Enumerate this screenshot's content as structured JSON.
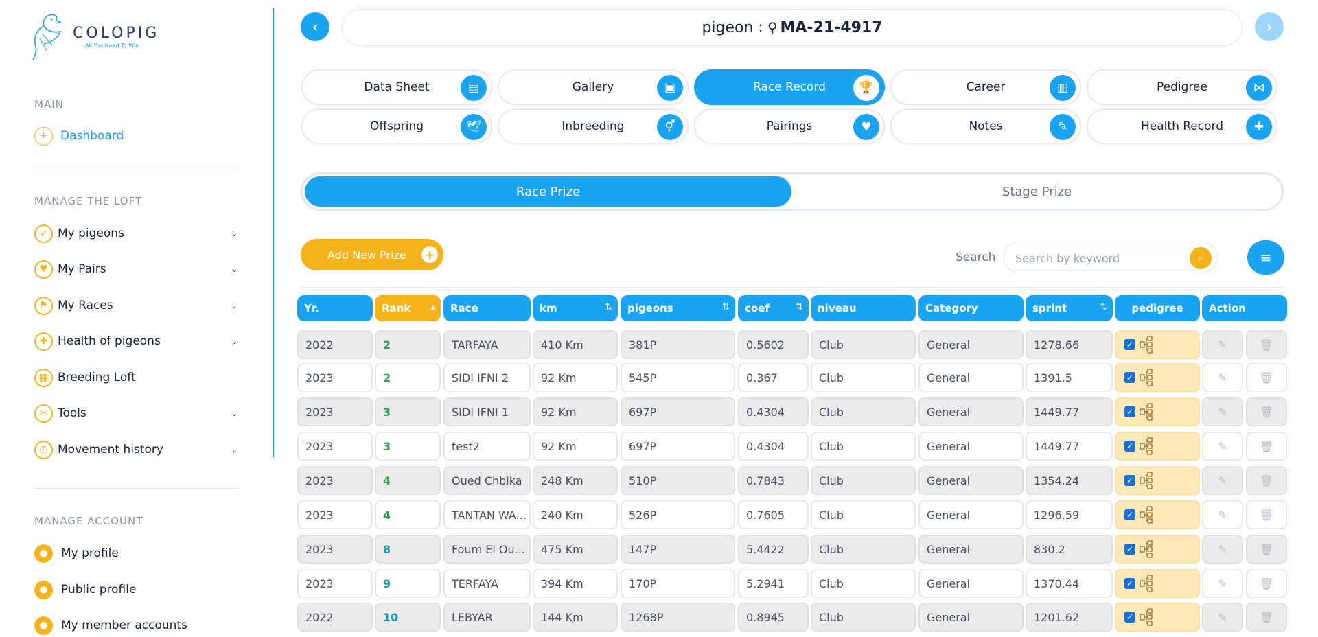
{
  "app": {
    "name": "COLOPIG",
    "tagline": "All You Need To Win"
  },
  "sidebar": {
    "main_title": "MAIN",
    "dashboard": "Dashboard",
    "loft_title": "MANAGE THE LOFT",
    "loft_items": [
      {
        "label": "My pigeons",
        "icon": "pigeon-icon"
      },
      {
        "label": "My Pairs",
        "icon": "pairs-icon"
      },
      {
        "label": "My Races",
        "icon": "flag-icon"
      },
      {
        "label": "Health of pigeons",
        "icon": "health-icon"
      },
      {
        "label": "Breeding Loft",
        "icon": "loft-icon"
      },
      {
        "label": "Tools",
        "icon": "tools-icon"
      },
      {
        "label": "Movement history",
        "icon": "clock-icon"
      }
    ],
    "account_title": "MANAGE ACCOUNT",
    "account_items": [
      {
        "label": "My profile",
        "icon": "user-icon"
      },
      {
        "label": "Public profile",
        "icon": "user-icon"
      },
      {
        "label": "My member accounts",
        "icon": "user-icon"
      }
    ]
  },
  "header": {
    "prefix": "pigeon :",
    "sex_symbol": "♀",
    "ring": "MA-21-4917"
  },
  "tabs": [
    {
      "label": "Data Sheet",
      "icon": "document-icon",
      "glyph": "▤"
    },
    {
      "label": "Gallery",
      "icon": "image-icon",
      "glyph": "▣"
    },
    {
      "label": "Race Record",
      "icon": "trophy-icon",
      "glyph": "🏆"
    },
    {
      "label": "Career",
      "icon": "chart-icon",
      "glyph": "▥"
    },
    {
      "label": "Pedigree",
      "icon": "share-icon",
      "glyph": "⋈"
    },
    {
      "label": "Offspring",
      "icon": "dove-icon",
      "glyph": "🕊"
    },
    {
      "label": "Inbreeding",
      "icon": "gender-icon",
      "glyph": "⚥"
    },
    {
      "label": "Pairings",
      "icon": "pair-birds-icon",
      "glyph": "♥"
    },
    {
      "label": "Notes",
      "icon": "notes-icon",
      "glyph": "✎"
    },
    {
      "label": "Health Record",
      "icon": "health-record-icon",
      "glyph": "✚"
    }
  ],
  "toggle": {
    "on": "Race Prize",
    "off": "Stage Prize"
  },
  "toolbar": {
    "add_label": "Add New Prize",
    "search_label": "Search",
    "search_placeholder": "Search by keyword"
  },
  "table": {
    "headers": [
      "Yr.",
      "Rank",
      "Race",
      "km",
      "pigeons",
      "coef",
      "niveau",
      "Category",
      "sprint",
      "pedigree",
      "Action"
    ],
    "rows": [
      {
        "yr": "2022",
        "rank": "2",
        "race": "TARFAYA",
        "km": "410 Km",
        "pigeons": "381P",
        "coef": "0.5602",
        "niveau": "Club",
        "category": "General",
        "sprint": "1278.66"
      },
      {
        "yr": "2023",
        "rank": "2",
        "race": "SIDI IFNI 2",
        "km": "92 Km",
        "pigeons": "545P",
        "coef": "0.367",
        "niveau": "Club",
        "category": "General",
        "sprint": "1391.5"
      },
      {
        "yr": "2023",
        "rank": "3",
        "race": "SIDI IFNI 1",
        "km": "92 Km",
        "pigeons": "697P",
        "coef": "0.4304",
        "niveau": "Club",
        "category": "General",
        "sprint": "1449.77"
      },
      {
        "yr": "2023",
        "rank": "3",
        "race": "test2",
        "km": "92 Km",
        "pigeons": "697P",
        "coef": "0.4304",
        "niveau": "Club",
        "category": "General",
        "sprint": "1449.77"
      },
      {
        "yr": "2023",
        "rank": "4",
        "race": "Oued Chbika",
        "km": "248 Km",
        "pigeons": "510P",
        "coef": "0.7843",
        "niveau": "Club",
        "category": "General",
        "sprint": "1354.24"
      },
      {
        "yr": "2023",
        "rank": "4",
        "race": "TANTAN WA...",
        "km": "240 Km",
        "pigeons": "526P",
        "coef": "0.7605",
        "niveau": "Club",
        "category": "General",
        "sprint": "1296.59"
      },
      {
        "yr": "2023",
        "rank": "8",
        "race": "Foum El Ou...",
        "km": "475 Km",
        "pigeons": "147P",
        "coef": "5.4422",
        "niveau": "Club",
        "category": "General",
        "sprint": "830.2"
      },
      {
        "yr": "2023",
        "rank": "9",
        "race": "TERFAYA",
        "km": "394 Km",
        "pigeons": "170P",
        "coef": "5.2941",
        "niveau": "Club",
        "category": "General",
        "sprint": "1370.44"
      },
      {
        "yr": "2022",
        "rank": "10",
        "race": "LEBYAR",
        "km": "144 Km",
        "pigeons": "1268P",
        "coef": "0.8945",
        "niveau": "Club",
        "category": "General",
        "sprint": "1201.62"
      }
    ]
  },
  "colors": {
    "primary": "#1aa3f0",
    "accent": "#f5b31b",
    "rank_green": "#2aa84a",
    "rank_teal": "#1a96a8",
    "pedigree_bg": "#fde8b8"
  }
}
